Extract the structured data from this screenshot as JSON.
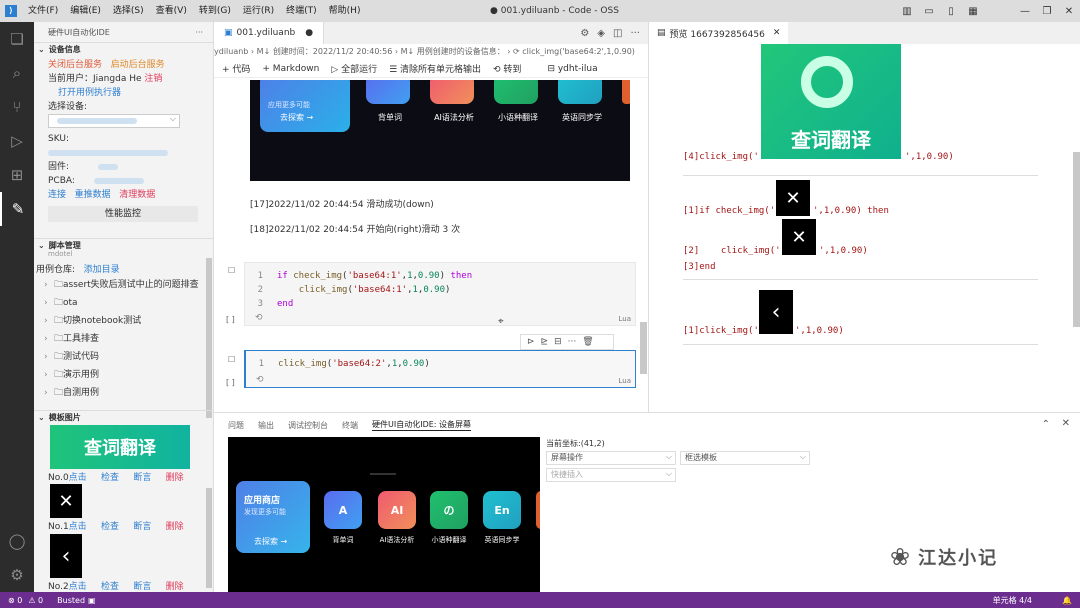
{
  "titlebar": {
    "menu": [
      "文件(F)",
      "编辑(E)",
      "选择(S)",
      "查看(V)",
      "转到(G)",
      "运行(R)",
      "终端(T)",
      "帮助(H)"
    ],
    "title": "● 001.ydiluanb - Code - OSS"
  },
  "sidebar": {
    "header": "硬件UI自动化IDE",
    "device_section": "设备信息",
    "close_service": "关闭后台服务",
    "start_service": "启动后台服务",
    "user_label": "当前用户：",
    "user_name": "Jiangda He",
    "logout": "注销",
    "open_executor": "打开用例执行器",
    "select_device": "选择设备:",
    "sku": "SKU:",
    "firmware": "固件:",
    "pcba": "PCBA:",
    "connect": "连接",
    "redata": "重推数据",
    "clear": "清理数据",
    "perf": "性能监控",
    "script_section": "脚本管理",
    "script_select": "mdotel",
    "repo_label": "用例仓库:",
    "add_dir": "添加目录",
    "tree": [
      "assert失败后测试中止的问题排查",
      "ota",
      "切换notebook测试",
      "工具排查",
      "测试代码",
      "演示用例",
      "自测用例"
    ],
    "template_section": "模板图片",
    "templates": [
      {
        "no": "No.0",
        "text": "查词翻译"
      },
      {
        "no": "No.1",
        "text": "✕"
      },
      {
        "no": "No.2",
        "text": "‹"
      }
    ],
    "tpl_actions": [
      "点击",
      "检查",
      "断言",
      "删除"
    ]
  },
  "editor": {
    "tab": "001.ydiluanb",
    "crumbs": "ydiluanb  › M↓ 创建时间：2022/11/2 20:40:56  › M↓ 用例创建时的设备信息：  › ⟳ click_img('base64:2',1,0.90)",
    "toolbar": [
      "+ 代码",
      "+ Markdown",
      "▷ 全部运行",
      "☰ 清除所有单元格输出",
      "⟲ 转到"
    ],
    "kernel": "ydht-ilua",
    "out_banner": "应用更多可能",
    "out_explore": "去探索 →",
    "out_apps": [
      "背单词",
      "AI语法分析",
      "小语种翻译",
      "英语同步学"
    ],
    "log1": "[17]2022/11/02 20:44:54 滑动成功(down)",
    "log2": "[18]2022/11/02 20:44:54 开始向(right)滑动 3 次",
    "cell1": [
      "if check_img('base64:1',1,0.90) then",
      "    click_img('base64:1',1,0.90)",
      "end"
    ],
    "cell2": "click_img('base64:2',1,0.90)",
    "cell_lang": "Lua",
    "cell_bracket": "[ ]"
  },
  "preview": {
    "tab": "预览 1667392856456",
    "img_text": "查词翻译",
    "lines": {
      "l1a": "[4]click_img('",
      "l1b": "',1,0.90)",
      "l2a": "[1]if check_img('",
      "l2b": "',1,0.90) then",
      "l3a": "[2]    click_img('",
      "l3b": "',1,0.90)",
      "l4": "[3]end",
      "l5a": "[1]click_img('",
      "l5b": "',1,0.90)"
    }
  },
  "panel": {
    "tabs": [
      "问题",
      "输出",
      "调试控制台",
      "终端",
      "硬件UI自动化IDE: 设备屏幕"
    ],
    "coord_label": "当前坐标:",
    "coord": "(41,2)",
    "screen_op": "屏幕操作",
    "frame_tpl": "框选模板",
    "quick_insert": "快捷插入",
    "store_title": "应用商店",
    "store_sub": "发现更多可能",
    "store_explore": "去探索 →",
    "apps": [
      "背单词",
      "AI语法分析",
      "小语种翻译",
      "英语同步学"
    ],
    "watermark": "江达小记"
  },
  "status": {
    "errors": "⊗ 0",
    "warnings": "⚠ 0",
    "busted": "Busted",
    "cell": "单元格 4/4"
  }
}
